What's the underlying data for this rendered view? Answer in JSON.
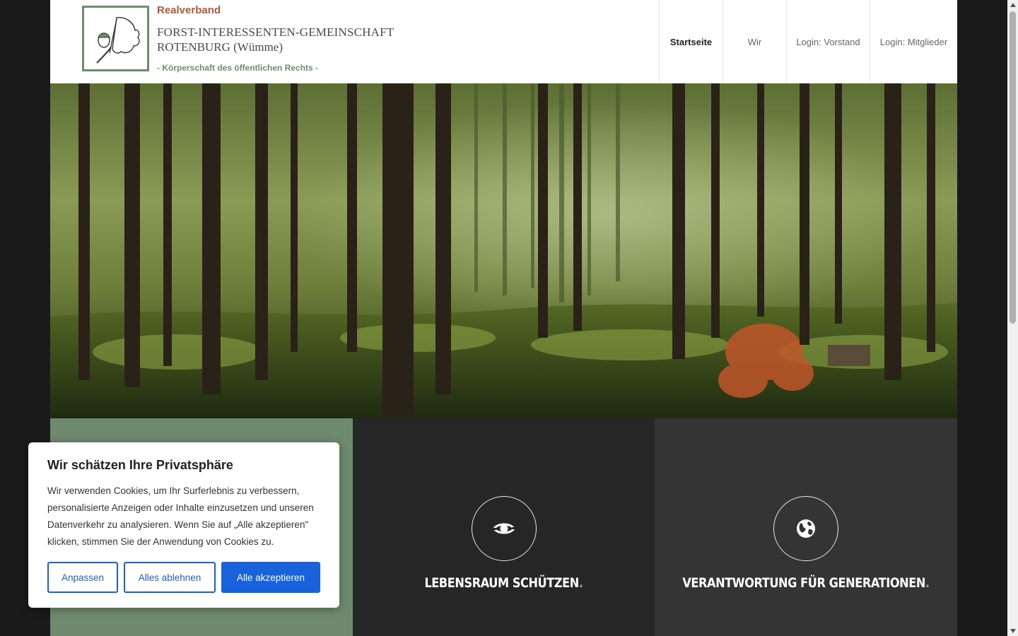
{
  "header": {
    "logo": {
      "realverband": "Realverband",
      "line1": "FORST-INTERESSENTEN-GEMEINSCHAFT",
      "line2": "ROTENBURG (Wümme)",
      "subtitle": "- Körperschaft des öffentlichen Rechts -"
    },
    "nav": [
      {
        "label": "Startseite",
        "active": true
      },
      {
        "label": "Wir",
        "active": false
      },
      {
        "label": "Login: Vorstand",
        "active": false
      },
      {
        "label": "Login: Mitglieder",
        "active": false
      }
    ]
  },
  "hero": {
    "image": "forest-photo"
  },
  "features": [
    {
      "title": "LEBENSRAUM SCHÜTZEN",
      "dot": ".",
      "icon": "eye-circular-icon"
    },
    {
      "title": "VERANTWORTUNG FÜR GENERATIONEN",
      "dot": ".",
      "icon": "globe-icon"
    }
  ],
  "cookie": {
    "title": "Wir schätzen Ihre Privatsphäre",
    "text": "Wir verwenden Cookies, um Ihr Surferlebnis zu verbessern, personalisierte Anzeigen oder Inhalte einzusetzen und unseren Datenverkehr zu analysieren. Wenn Sie auf „Alle akzeptieren\" klicken, stimmen Sie der Anwendung von Cookies zu.",
    "customize_label": "Anpassen",
    "reject_label": "Alles ablehnen",
    "accept_label": "Alle akzeptieren"
  },
  "colors": {
    "accent": "#1863dc",
    "green_panel": "#6f896f",
    "dark_panel": "#262626",
    "logo_brown": "#b05a3e"
  }
}
